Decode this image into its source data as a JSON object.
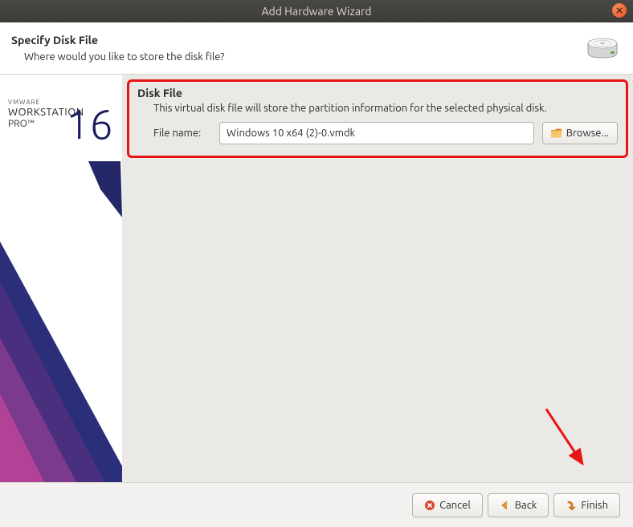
{
  "titlebar": {
    "title": "Add Hardware Wizard"
  },
  "header": {
    "title": "Specify Disk File",
    "subtitle": "Where would you like to store the disk file?"
  },
  "sidebar": {
    "brand_small": "VMWARE",
    "brand_main": "WORKSTATION",
    "brand_pro": "PRO™",
    "brand_version": "16"
  },
  "main": {
    "section_title": "Disk File",
    "section_desc": "This virtual disk file will store the partition information for the selected physical disk.",
    "filename_label": "File name:",
    "filename_value": "Windows 10 x64 (2)-0.vmdk",
    "browse_label": "Browse..."
  },
  "footer": {
    "cancel_label": "Cancel",
    "back_label": "Back",
    "finish_label": "Finish"
  }
}
